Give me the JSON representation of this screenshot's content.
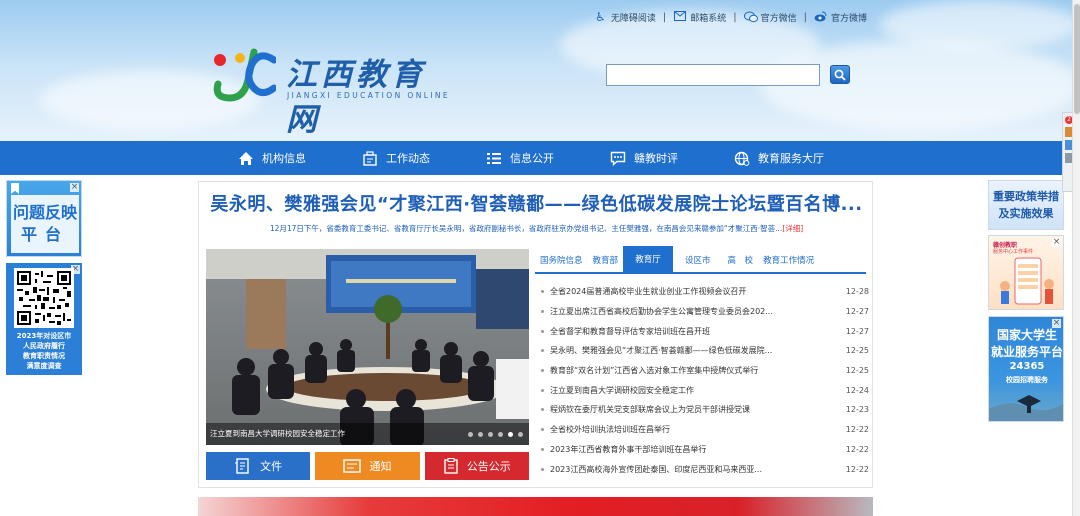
{
  "toplinks": [
    {
      "icon": "accessibility-icon",
      "label": "无障碍阅读"
    },
    {
      "icon": "mail-icon",
      "label": "邮箱系统"
    },
    {
      "icon": "wechat-icon",
      "label": "官方微信"
    },
    {
      "icon": "weibo-icon",
      "label": "官方微博"
    }
  ],
  "logo": {
    "cn": "江西教育网",
    "en": "JIANGXI EDUCATION ONLINE"
  },
  "search": {
    "value": "",
    "placeholder": ""
  },
  "nav": [
    {
      "icon": "home-icon",
      "label": "机构信息"
    },
    {
      "icon": "workflow-icon",
      "label": "工作动态"
    },
    {
      "icon": "list-icon",
      "label": "信息公开"
    },
    {
      "icon": "comment-icon",
      "label": "赣教时评"
    },
    {
      "icon": "globe-service-icon",
      "label": "教育服务大厅"
    }
  ],
  "left_ads": {
    "feedback": {
      "line1": "问题反映",
      "line2": "平台"
    },
    "survey": {
      "lines": [
        "2023年对设区市",
        "人民政府履行",
        "教育职责情况",
        "满意度调查"
      ]
    }
  },
  "right_ads": {
    "policy": {
      "line1": "重要政策举措",
      "line2": "及实施效果"
    },
    "recruit": {
      "line1": "赣创教职",
      "line2": "服务中心工作事件"
    },
    "career": {
      "line1": "国家大学生",
      "line2": "就业服务平台",
      "line3": "24365",
      "line4": "校园招聘服务"
    }
  },
  "side_widget": {
    "badge": "2"
  },
  "headline": {
    "title": "吴永明、樊雅强会见“才聚江西·智荟赣鄱——绿色低碳发展院士论坛暨百名博...",
    "summary": "12月17日下午，省委教育工委书记、省教育厅厅长吴永明，省政府副秘书长，省政府驻京办党组书记、主任樊雅强，在南昌会见来赣参加“才聚江西·智荟...",
    "more": "[详细]"
  },
  "photo": {
    "caption": "汪立夏到南昌大学调研校园安全稳定工作",
    "dots": 6,
    "active_dot": 5
  },
  "quick_buttons": [
    {
      "icon": "document-icon",
      "label": "文件"
    },
    {
      "icon": "notice-icon",
      "label": "通知"
    },
    {
      "icon": "announcement-icon",
      "label": "公告公示"
    }
  ],
  "tabs": [
    {
      "label": "国务院信息",
      "active": false
    },
    {
      "label": "教育部",
      "active": false
    },
    {
      "label": "教育厅",
      "active": true
    },
    {
      "label": "设区市",
      "active": false
    },
    {
      "label": "高　校",
      "active": false
    },
    {
      "label": "教育工作情况",
      "active": false
    }
  ],
  "news": [
    {
      "title": "全省2024届普通高校毕业生就业创业工作视频会议召开",
      "date": "12-28"
    },
    {
      "title": "汪立夏出席江西省高校后勤协会学生公寓管理专业委员会202...",
      "date": "12-27"
    },
    {
      "title": "全省督学和教育督导评估专家培训班在昌开班",
      "date": "12-27"
    },
    {
      "title": "吴永明、樊雅强会见“才聚江西·智荟赣鄱——绿色低碳发展院...",
      "date": "12-25"
    },
    {
      "title": "教育部“双名计划”江西省入选对象工作室集中授牌仪式举行",
      "date": "12-25"
    },
    {
      "title": "汪立夏到南昌大学调研校园安全稳定工作",
      "date": "12-24"
    },
    {
      "title": "程炳钦在委厅机关党支部联席会议上为党员干部讲授党课",
      "date": "12-23"
    },
    {
      "title": "全省校外培训执法培训班在昌举行",
      "date": "12-22"
    },
    {
      "title": "2023年江西省教育外事干部培训班在昌举行",
      "date": "12-22"
    },
    {
      "title": "2023江西高校海外宣传团赴泰国、印度尼西亚和马来西亚...",
      "date": "12-22"
    }
  ],
  "colors": {
    "primary": "#1f6fce",
    "orange": "#ee8a22",
    "red": "#d4292f"
  }
}
